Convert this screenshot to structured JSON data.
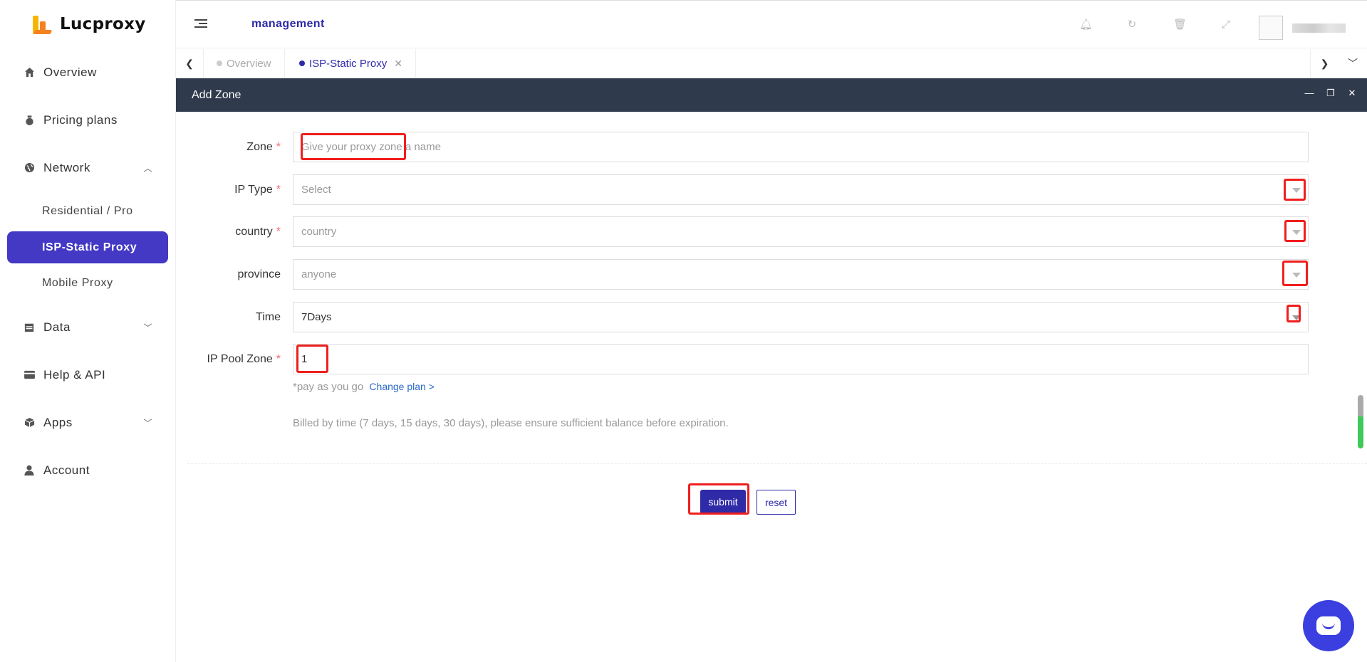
{
  "brand": {
    "name": "Lucproxy"
  },
  "header": {
    "title": "management"
  },
  "sidebar": {
    "items": [
      {
        "label": "Overview",
        "icon": "home-icon"
      },
      {
        "label": "Pricing plans",
        "icon": "money-bag-icon"
      },
      {
        "label": "Network",
        "icon": "globe-icon",
        "expanded": true
      },
      {
        "label": "Residential / Pro"
      },
      {
        "label": "ISP-Static Proxy",
        "active": true
      },
      {
        "label": "Mobile Proxy"
      },
      {
        "label": "Data",
        "icon": "calendar-icon"
      },
      {
        "label": "Help & API",
        "icon": "card-icon"
      },
      {
        "label": "Apps",
        "icon": "cube-icon"
      },
      {
        "label": "Account",
        "icon": "user-icon"
      }
    ]
  },
  "tabs": [
    {
      "label": "Overview",
      "active": false
    },
    {
      "label": "ISP-Static Proxy",
      "active": true
    }
  ],
  "dialog": {
    "title": "Add Zone"
  },
  "form": {
    "zone": {
      "label": "Zone",
      "placeholder": "Give your proxy zone a name",
      "required": true
    },
    "ip_type": {
      "label": "IP Type",
      "value": "Select",
      "required": true
    },
    "country": {
      "label": "country",
      "value": "country",
      "required": true
    },
    "province": {
      "label": "province",
      "value": "anyone",
      "required": false
    },
    "time": {
      "label": "Time",
      "value": "7Days",
      "required": false
    },
    "ip_pool_zone": {
      "label": "IP Pool Zone",
      "value": "1",
      "required": true
    },
    "note": "*pay as you go",
    "change_plan": "Change plan >",
    "billed_text": "Billed by time (7 days, 15 days, 30 days), please ensure sufficient balance before expiration.",
    "submit_label": "submit",
    "reset_label": "reset"
  },
  "colors": {
    "accent": "#2e2aa8",
    "sidebar_active": "#4339c4",
    "dialog_header": "#2f3b4c",
    "highlight": "#f01e1e"
  }
}
